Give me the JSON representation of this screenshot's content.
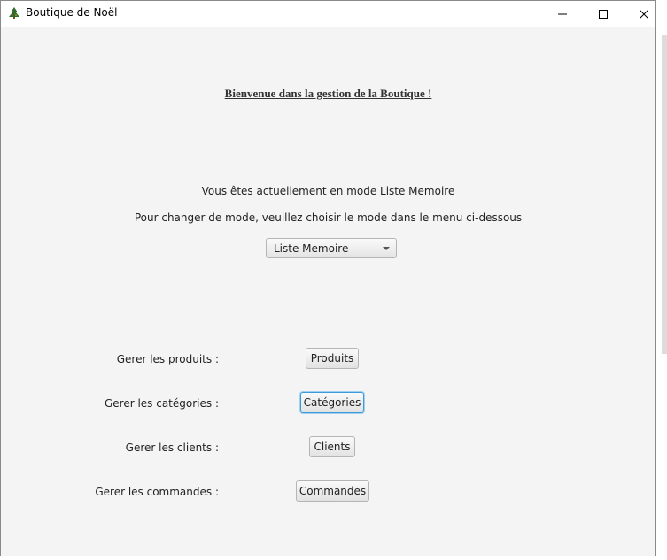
{
  "window": {
    "title": "Boutique de Noël",
    "icon": "christmas-tree-icon"
  },
  "titlebar_buttons": {
    "minimize": "minimize-icon",
    "maximize": "maximize-icon",
    "close": "close-icon"
  },
  "main": {
    "welcome": "Bienvenue dans la gestion de la Boutique !",
    "current_mode_text": "Vous êtes actuellement en mode Liste Memoire",
    "change_mode_text": "Pour changer de mode, veuillez choisir le mode dans le menu ci-dessous",
    "mode_select": {
      "selected": "Liste Memoire"
    }
  },
  "actions": [
    {
      "label": "Gerer les produits :",
      "button": "Produits"
    },
    {
      "label": "Gerer les catégories :",
      "button": "Catégories"
    },
    {
      "label": "Gerer les clients :",
      "button": "Clients"
    },
    {
      "label": "Gerer les commandes :",
      "button": "Commandes"
    }
  ],
  "colors": {
    "window_bg": "#f4f4f4",
    "focus_border": "#3c9ad8"
  }
}
